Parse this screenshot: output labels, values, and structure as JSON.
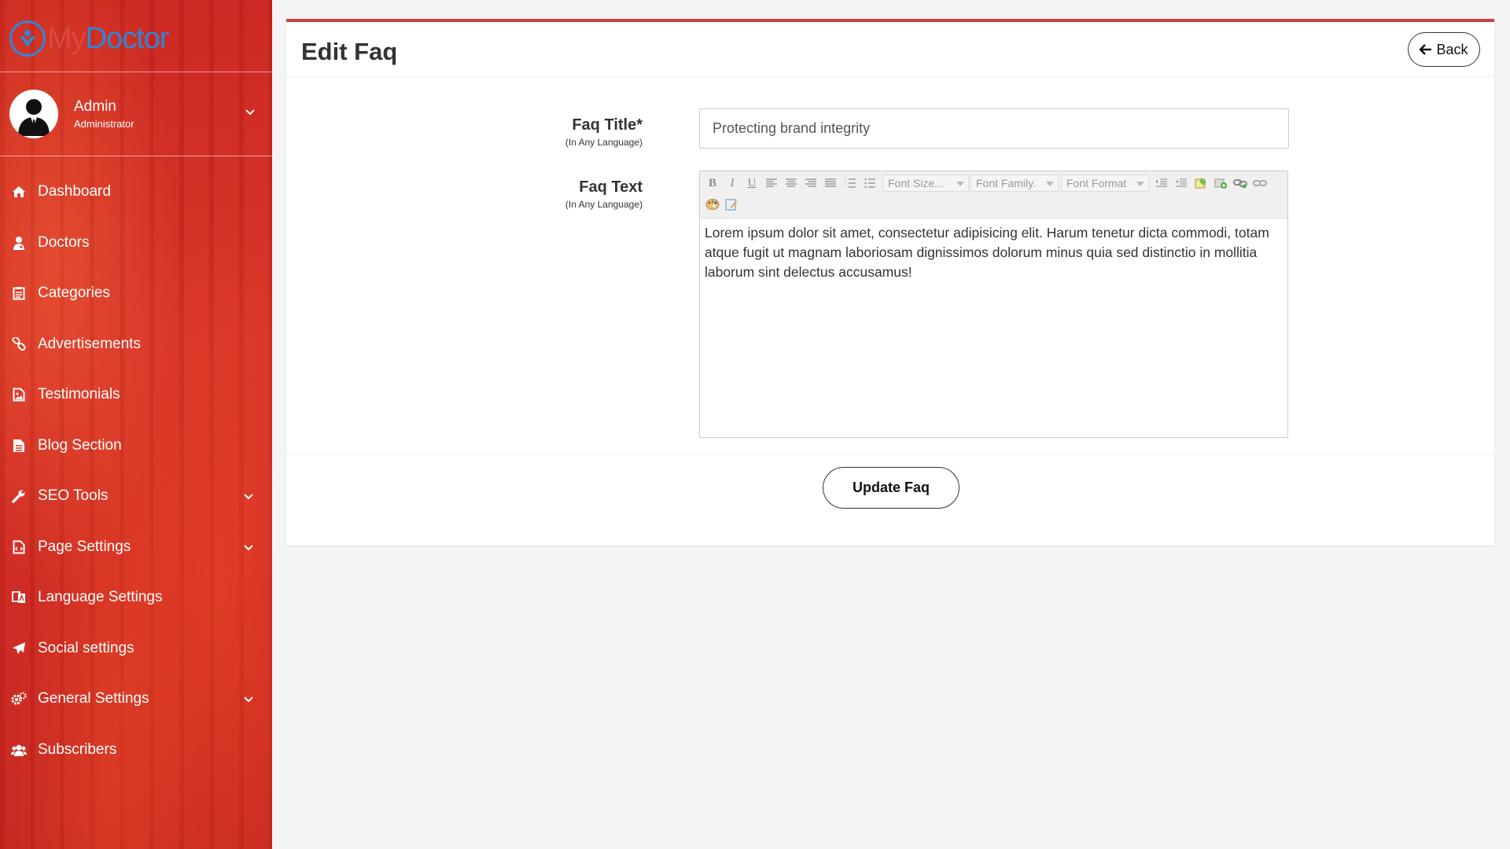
{
  "brand": {
    "logo_my": "My",
    "logo_doctor": "Doctor"
  },
  "user": {
    "name": "Admin",
    "role": "Administrator"
  },
  "sidebar": {
    "items": [
      {
        "label": "Dashboard",
        "icon": "home-icon",
        "has_caret": false
      },
      {
        "label": "Doctors",
        "icon": "user-md-icon",
        "has_caret": false
      },
      {
        "label": "Categories",
        "icon": "clipboard-icon",
        "has_caret": false
      },
      {
        "label": "Advertisements",
        "icon": "link-icon",
        "has_caret": false
      },
      {
        "label": "Testimonials",
        "icon": "image-file-icon",
        "has_caret": false
      },
      {
        "label": "Blog Section",
        "icon": "document-icon",
        "has_caret": false
      },
      {
        "label": "SEO Tools",
        "icon": "wrench-icon",
        "has_caret": true
      },
      {
        "label": "Page Settings",
        "icon": "code-file-icon",
        "has_caret": true
      },
      {
        "label": "Language Settings",
        "icon": "language-icon",
        "has_caret": false
      },
      {
        "label": "Social settings",
        "icon": "paper-plane-icon",
        "has_caret": false
      },
      {
        "label": "General Settings",
        "icon": "cogs-icon",
        "has_caret": true
      },
      {
        "label": "Subscribers",
        "icon": "users-icon",
        "has_caret": false
      }
    ]
  },
  "page": {
    "title": "Edit Faq",
    "back_label": "Back"
  },
  "form": {
    "title_label": "Faq Title*",
    "title_sublabel": "(In Any Language)",
    "title_value": "Protecting brand integrity",
    "text_label": "Faq Text",
    "text_sublabel": "(In Any Language)",
    "text_value": "Lorem ipsum dolor sit amet, consectetur adipisicing elit. Harum tenetur dicta commodi, totam atque fugit ut magnam laboriosam dignissimos dolorum minus quia sed distinctio in mollitia laborum sint delectus accusamus!",
    "submit_label": "Update Faq"
  },
  "editor_toolbar": {
    "bold": "B",
    "italic": "I",
    "underline": "U",
    "font_size": "Font Size...",
    "font_family": "Font Family.",
    "font_format": "Font Format"
  },
  "colors": {
    "sidebar_red": "#d8352a",
    "card_accent": "#c9403f",
    "logo_blue": "#2f86d8"
  }
}
